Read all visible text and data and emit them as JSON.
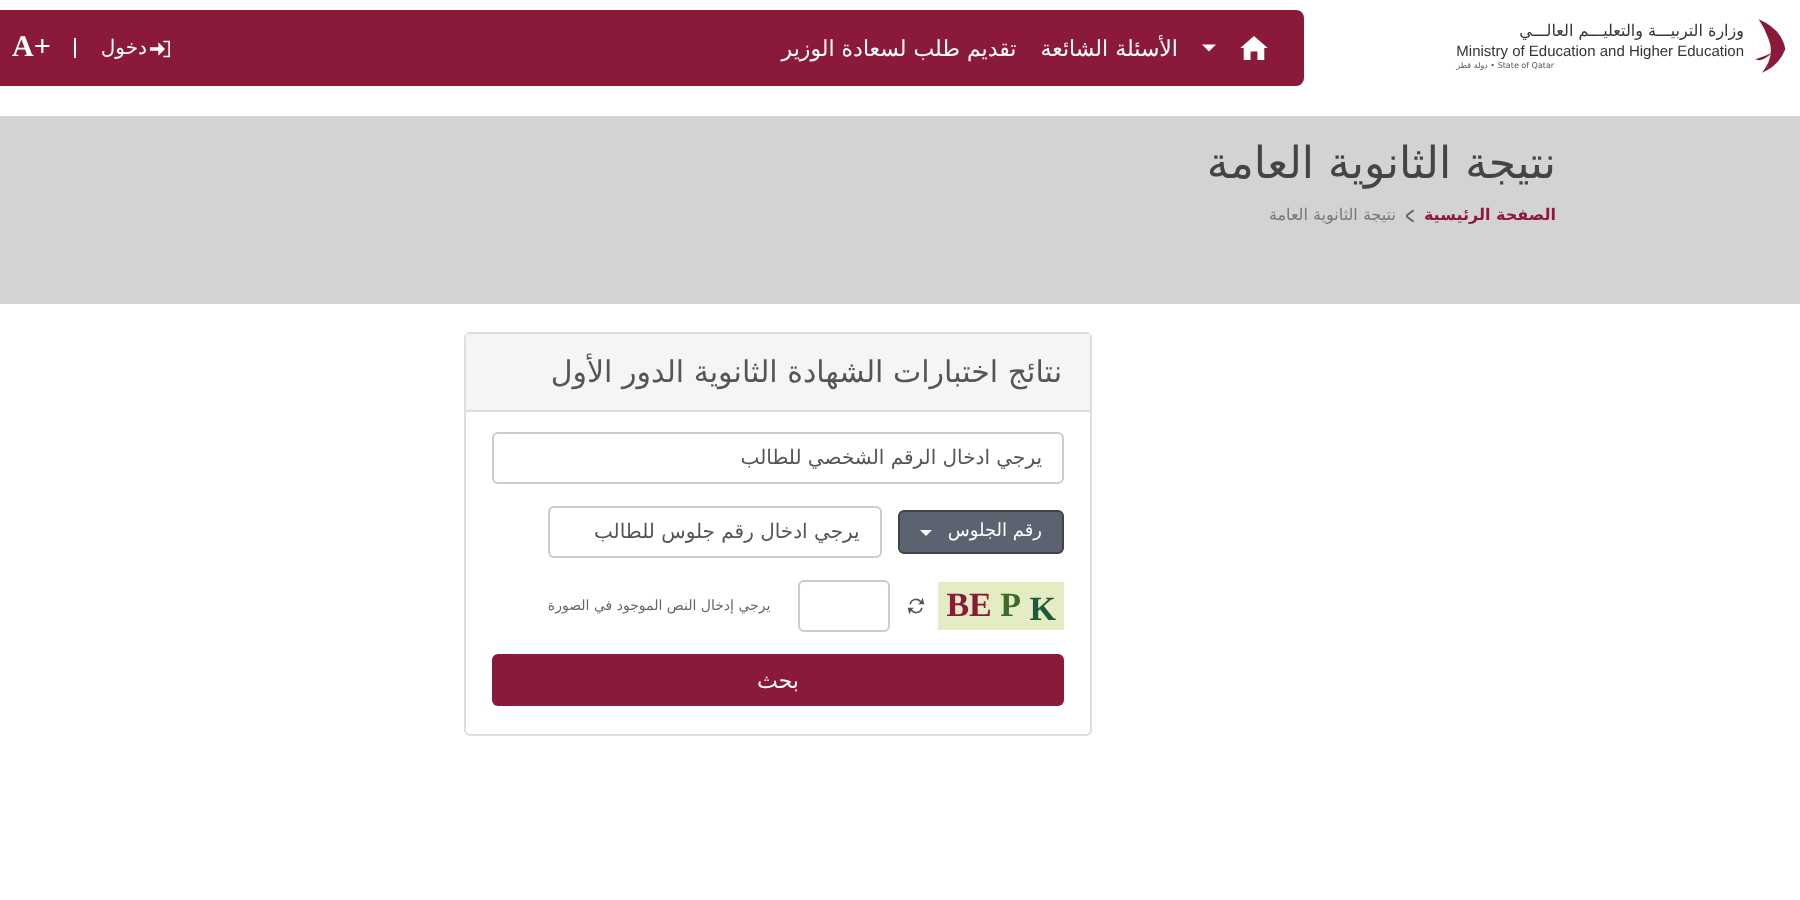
{
  "logo": {
    "arabic": "وزارة التربيـــة والتعليـــم العالـــي",
    "english": "Ministry of Education and Higher Education",
    "state": "State of Qatar • دولة قطر"
  },
  "nav": {
    "items": [
      {
        "label": "الأسئلة الشائعة"
      },
      {
        "label": "تقديم طلب لسعادة الوزير"
      }
    ],
    "login": "دخول",
    "font_size": "A+"
  },
  "banner": {
    "title": "نتيجة الثانوية العامة",
    "breadcrumb": [
      {
        "label": "الصفحة الرئيسية",
        "link": true
      },
      {
        "label": "نتيجة الثانوية العامة",
        "link": false
      }
    ]
  },
  "form": {
    "title": "نتائج اختبارات الشهادة الثانوية الدور الأول",
    "id_field": {
      "placeholder": "يرجي ادخال الرقم الشخصي للطالب"
    },
    "seat_dropdown": "رقم الجلوس",
    "seat_field": {
      "placeholder": "يرجي ادخال رقم جلوس للطالب"
    },
    "captcha": "BE P K",
    "captcha_hint": "يرجي إدخال النص الموجود في الصورة",
    "submit": "بحث"
  }
}
